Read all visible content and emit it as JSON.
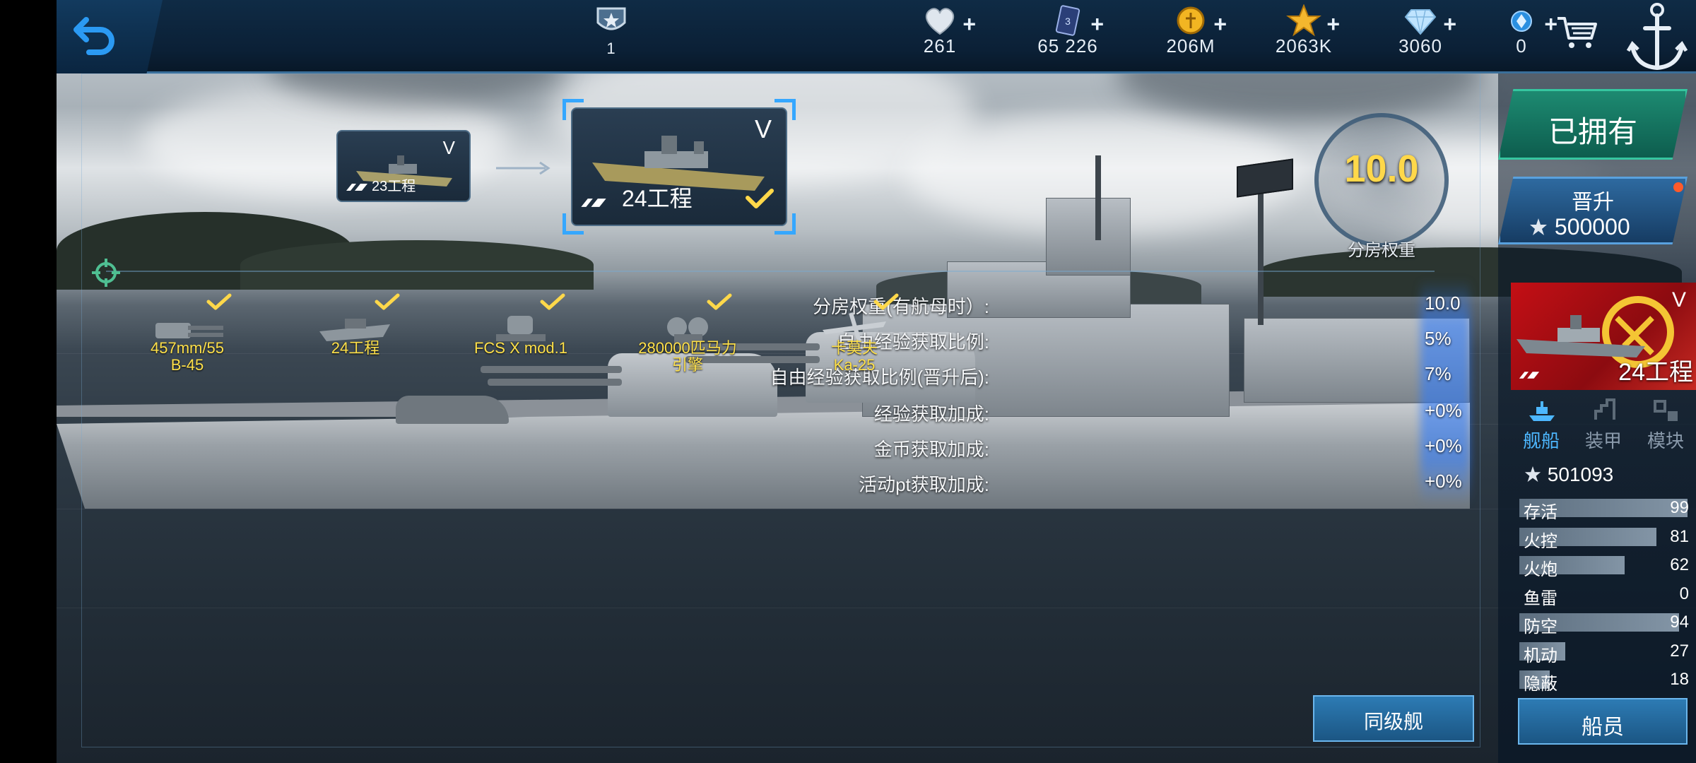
{
  "topbar": {
    "rank_value": "1",
    "hearts": "261",
    "cards": "65 226",
    "gold": "206M",
    "stars": "2063K",
    "diamonds": "3060",
    "special": "0"
  },
  "upgrade": {
    "from_name": "23工程",
    "from_tier": "V",
    "to_name": "24工程",
    "to_tier": "V"
  },
  "weight": {
    "value": "10.0",
    "label": "分房权重"
  },
  "stats": [
    {
      "label": "分房权重(有航母时）:",
      "value": "10.0"
    },
    {
      "label": "自由经验获取比例:",
      "value": "5%"
    },
    {
      "label": "自由经验获取比例(晋升后):",
      "value": "7%"
    },
    {
      "label": "经验获取加成:",
      "value": "+0%"
    },
    {
      "label": "金币获取加成:",
      "value": "+0%"
    },
    {
      "label": "活动pt获取加成:",
      "value": "+0%"
    }
  ],
  "modules": [
    {
      "line1": "457mm/55",
      "line2": "B-45",
      "icon": "gun-icon"
    },
    {
      "line1": "24工程",
      "line2": "",
      "icon": "hull-icon"
    },
    {
      "line1": "FCS X mod.1",
      "line2": "",
      "icon": "fire-control-icon"
    },
    {
      "line1": "280000匹马力",
      "line2": "引擎",
      "icon": "engine-icon"
    },
    {
      "line1": "卡莫夫",
      "line2": "Ka-25",
      "icon": "aircraft-icon"
    }
  ],
  "right_panel": {
    "owned_label": "已拥有",
    "promote_label": "晋升",
    "promote_cost": "500000",
    "ship_name": "24工程",
    "ship_tier": "V",
    "tabs": [
      "舰船",
      "装甲",
      "模块"
    ],
    "rank_points": "501093",
    "attributes": [
      {
        "label": "存活",
        "value": 99
      },
      {
        "label": "火控",
        "value": 81
      },
      {
        "label": "火炮",
        "value": 62
      },
      {
        "label": "鱼雷",
        "value": 0
      },
      {
        "label": "防空",
        "value": 94
      },
      {
        "label": "机动",
        "value": 27
      },
      {
        "label": "隐蔽",
        "value": 18
      }
    ],
    "crew_label": "船员"
  },
  "same_tier_label": "同级舰",
  "colors": {
    "accent_gold": "#ffd84a",
    "module_yellow": "#ffe14a",
    "owned_green": "#1d8a71",
    "promote_blue": "#2e6aa0",
    "tab_active": "#4db7ff",
    "flag_red": "#c40f15"
  }
}
